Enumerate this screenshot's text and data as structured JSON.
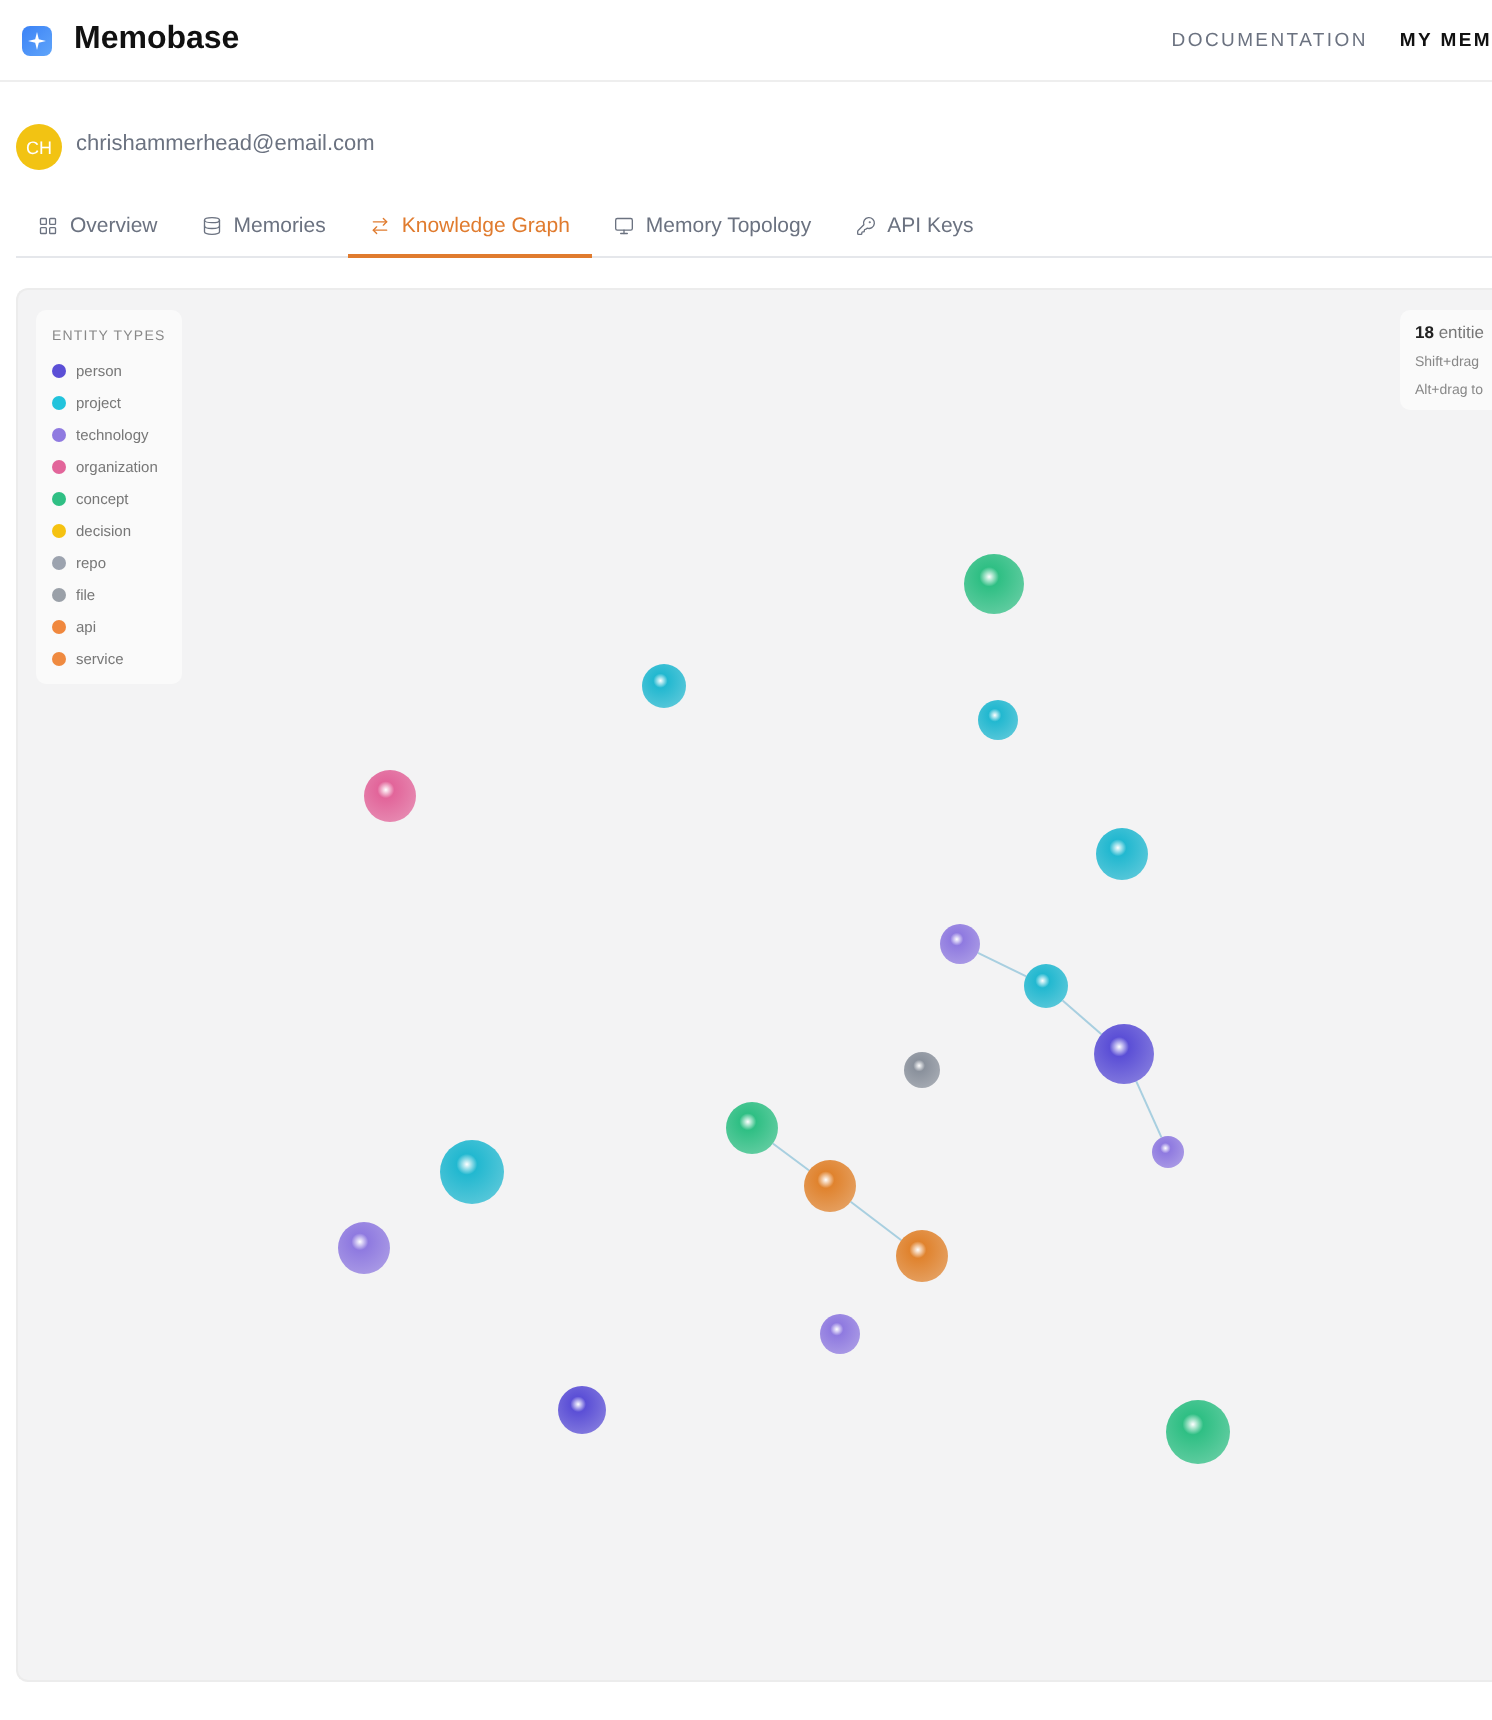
{
  "brand": {
    "name": "Memobase"
  },
  "nav": [
    "DOCUMENTATION",
    "MY MEM"
  ],
  "user": {
    "initials": "CH",
    "email": "chrishammerhead@email.com"
  },
  "tabs": [
    {
      "label": "Overview",
      "selected": false
    },
    {
      "label": "Memories",
      "selected": false
    },
    {
      "label": "Knowledge Graph",
      "selected": true
    },
    {
      "label": "Memory Topology",
      "selected": false
    },
    {
      "label": "API Keys",
      "selected": false
    }
  ],
  "legend": {
    "title": "ENTITY TYPES",
    "items": [
      {
        "label": "person",
        "color": "#5b4fd6"
      },
      {
        "label": "project",
        "color": "#22c3dc"
      },
      {
        "label": "technology",
        "color": "#8f7ae0"
      },
      {
        "label": "organization",
        "color": "#e2659a"
      },
      {
        "label": "concept",
        "color": "#2fbf84"
      },
      {
        "label": "decision",
        "color": "#f5c211"
      },
      {
        "label": "repo",
        "color": "#9ca3af"
      },
      {
        "label": "file",
        "color": "#9aa0a8"
      },
      {
        "label": "api",
        "color": "#f0883e"
      },
      {
        "label": "service",
        "color": "#ef8a40"
      }
    ]
  },
  "stats": {
    "count": "18",
    "count_label": "entitie",
    "hints": [
      "Shift+drag",
      "Alt+drag to"
    ]
  },
  "graph": {
    "nodes": [
      {
        "color": "#2fbf84"
      },
      {
        "color": "#22b8d0"
      },
      {
        "color": "#22b8d0"
      },
      {
        "color": "#e2659a"
      },
      {
        "color": "#22b8d0"
      },
      {
        "color": "#8f7ae0"
      },
      {
        "color": "#22b8d0"
      },
      {
        "color": "#5b4fd6"
      },
      {
        "color": "#8a919c"
      },
      {
        "color": "#8f7ae0"
      },
      {
        "color": "#2fbf84"
      },
      {
        "color": "#22b8d0"
      },
      {
        "color": "#e0832e"
      },
      {
        "color": "#8f7ae0"
      },
      {
        "color": "#e0832e"
      },
      {
        "color": "#8f7ae0"
      },
      {
        "color": "#5b4fd6"
      },
      {
        "color": "#2fbf84"
      }
    ]
  }
}
